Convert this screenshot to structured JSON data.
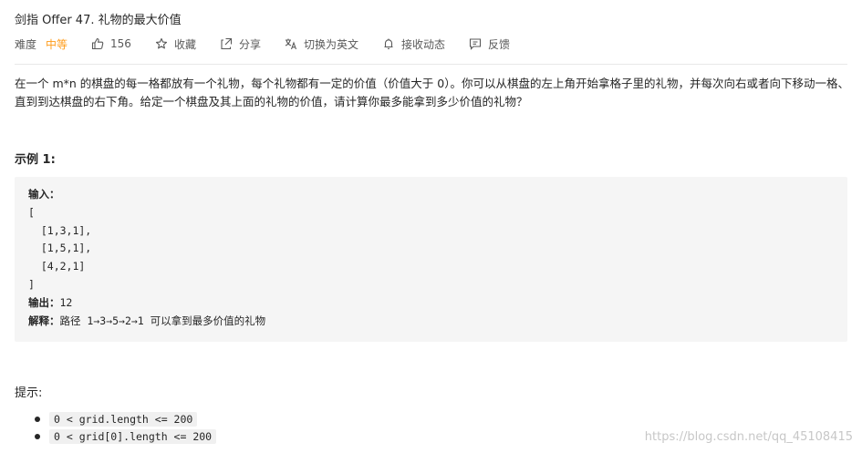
{
  "problem": {
    "title": "剑指 Offer 47. 礼物的最大价值",
    "difficulty_label": "难度",
    "difficulty": "中等"
  },
  "actions": {
    "likes": "156",
    "favorite": "收藏",
    "share": "分享",
    "switch_lang": "切换为英文",
    "subscribe": "接收动态",
    "feedback": "反馈"
  },
  "description": "在一个 m*n 的棋盘的每一格都放有一个礼物，每个礼物都有一定的价值（价值大于 0）。你可以从棋盘的左上角开始拿格子里的礼物，并每次向右或者向下移动一格、直到到达棋盘的右下角。给定一个棋盘及其上面的礼物的价值，请计算你最多能拿到多少价值的礼物？",
  "example": {
    "title": "示例 1:",
    "input_label": "输入：",
    "input_lines": [
      "[",
      "  [1,3,1],",
      "  [1,5,1],",
      "  [4,2,1]",
      "]"
    ],
    "output_label": "输出：",
    "output_value": "12",
    "explain_label": "解释：",
    "explain_value": "路径 1→3→5→2→1 可以拿到最多价值的礼物"
  },
  "hints": {
    "title": "提示:",
    "items": [
      "0 < grid.length <= 200",
      "0 < grid[0].length <= 200"
    ]
  },
  "watermark": "https://blog.csdn.net/qq_45108415",
  "icons": {
    "likes": "thumbs-up-icon",
    "favorite": "star-icon",
    "share": "share-icon",
    "switch_lang": "translate-icon",
    "subscribe": "bell-icon",
    "feedback": "feedback-icon"
  },
  "colors": {
    "difficulty_medium": "#ff9c1a",
    "example_bg": "#f5f5f5"
  }
}
